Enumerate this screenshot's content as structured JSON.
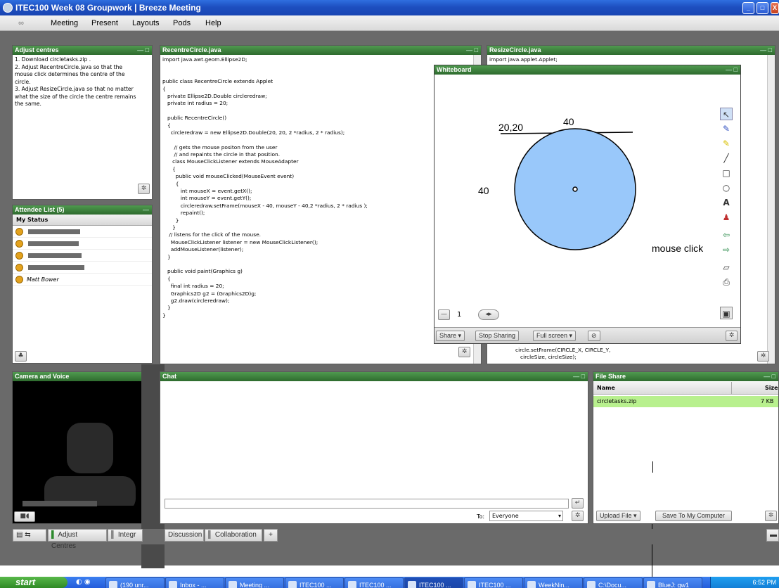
{
  "window": {
    "title": "ITEC100 Week 08 Groupwork | Breeze Meeting",
    "min": "_",
    "max": "□",
    "close": "X"
  },
  "menu": [
    "Meeting",
    "Present",
    "Layouts",
    "Pods",
    "Help"
  ],
  "adjust": {
    "title": "Adjust centres",
    "lines": [
      "1. Download circletasks.zip .",
      "2. Adjust RecentreCircle.java so that the",
      "mouse click determines the centre of the",
      "circle.",
      "3. Adjust ResizeCircle.java so that no matter",
      "what the size of the circle the centre remains",
      "the same."
    ]
  },
  "attendee": {
    "title": "Attendee List (5)",
    "status_label": "My Status",
    "names": [
      "",
      "",
      "",
      "",
      "Matt Bower"
    ]
  },
  "recentre": {
    "title": "RecentreCircle.java",
    "code": [
      "import java.awt.geom.Ellipse2D;",
      "",
      "",
      "public class RecentreCircle extends Applet",
      "{",
      "   private Ellipse2D.Double circleredraw;",
      "   private int radius = 20;",
      "",
      "   public RecentreCircle()",
      "   {",
      "     circleredraw = new Ellipse2D.Double(20, 20, 2 *radius, 2 * radius);",
      "",
      "       // gets the mouse positon from the user",
      "       // and repaints the circle in that position.",
      "      class MouseClickListener extends MouseAdapter",
      "      {",
      "        public void mouseClicked(MouseEvent event)",
      "        {",
      "           int mouseX = event.getX();",
      "           int mouseY = event.getY();",
      "           circleredraw.setFrame(mouseX - 40, mouseY - 40,2 *radius, 2 * radius );",
      "           repaint();",
      "        }",
      "      }",
      "    // listens for the click of the mouse.",
      "     MouseClickListener listener = new MouseClickListener();",
      "     addMouseListener(listener);",
      "   }",
      "",
      "   public void paint(Graphics g)",
      "   {",
      "     final int radius = 20;",
      "     Graphics2D g2 = (Graphics2D)g;",
      "     g2.draw(circleredraw);",
      "   }",
      "}"
    ]
  },
  "resize": {
    "title": "ResizeCircle.java",
    "first_line": "import java.applet.Applet;",
    "bottom_lines": [
      "circle.setFrame(CIRCLE_X, CIRCLE_Y,",
      "   circleSize, circleSize);"
    ]
  },
  "whiteboard": {
    "title": "Whiteboard",
    "labels": {
      "top": "40",
      "corner": "20,20",
      "left": "40",
      "click": "mouse click"
    },
    "page": "1",
    "share": "Share",
    "stop": "Stop Sharing",
    "fullscreen": "Full screen",
    "circle_fill": "#99c8fa"
  },
  "camera": {
    "title": "Camera and Voice"
  },
  "chat": {
    "title": "Chat",
    "to_label": "To:",
    "to_value": "Everyone"
  },
  "fileshare": {
    "title": "File Share",
    "col_name": "Name",
    "col_size": "Size",
    "file_name": "circletasks.zip",
    "file_size": "7 KB",
    "upload": "Upload File",
    "save": "Save To My Computer",
    "highlight": "#b8f08e"
  },
  "tabs": [
    "Adjust Centres",
    "Integr",
    "Discussion",
    "Collaboration",
    "+"
  ],
  "taskbar": {
    "start": "start",
    "items": [
      "(190 unr...",
      "Inbox - ...",
      "Meeting ...",
      "ITEC100 ...",
      "ITEC100 ...",
      "ITEC100 ...",
      "ITEC100 ...",
      "WeekNin...",
      "C:\\Docu...",
      "BlueJ: gw1"
    ],
    "clock": "6:52 PM"
  }
}
